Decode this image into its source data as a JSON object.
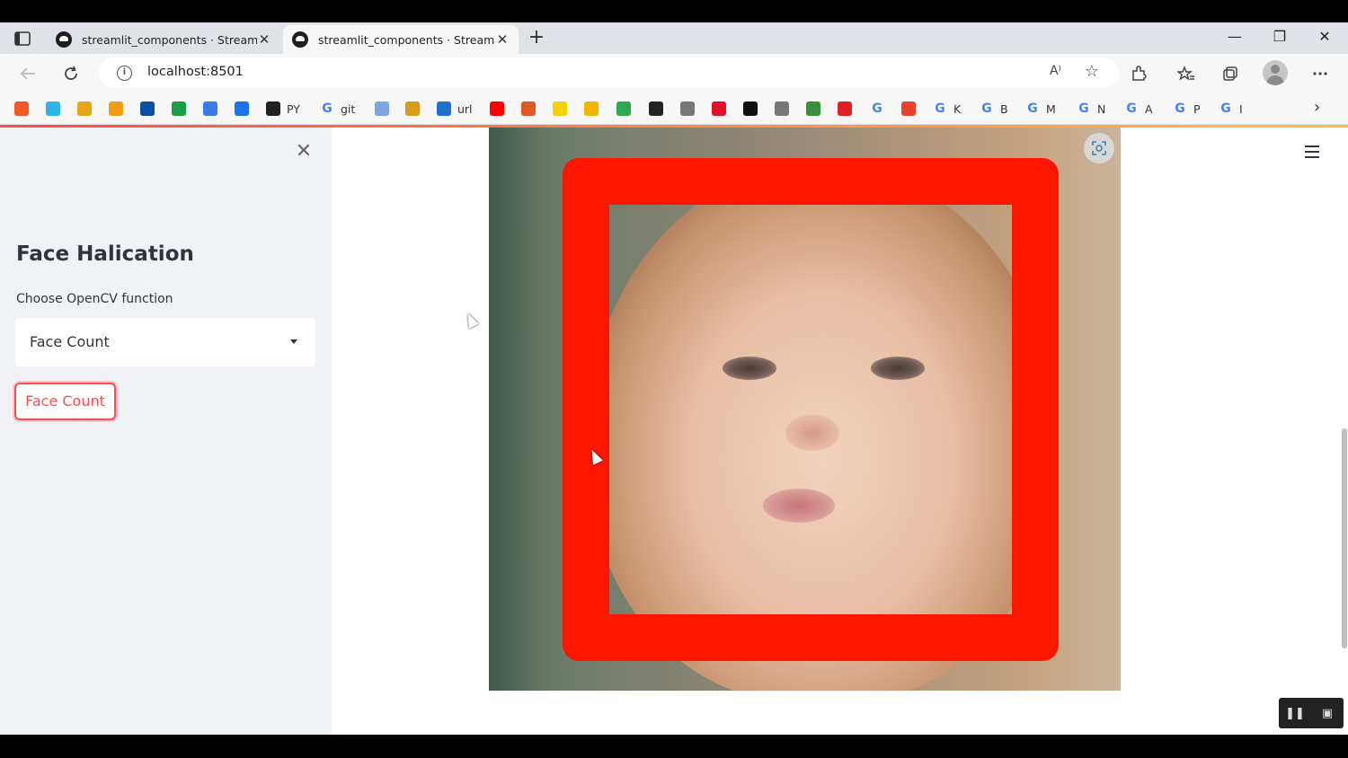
{
  "browser": {
    "tabs": [
      {
        "title": "streamlit_components · Streamlit",
        "active": false
      },
      {
        "title": "streamlit_components · Streamlit",
        "active": true
      }
    ],
    "new_tab_symbol": "+",
    "window_controls": {
      "minimize": "—",
      "restore": "❐",
      "close": "✕"
    },
    "url": "localhost:8501",
    "read_aloud": "A⁾",
    "bookmarks": [
      {
        "label": "",
        "icon": "bookmark-1-icon",
        "color": "#f05a28"
      },
      {
        "label": "",
        "icon": "bookmark-2-icon",
        "color": "#2fb4e8"
      },
      {
        "label": "",
        "icon": "bookmark-3-icon",
        "color": "#e8a417"
      },
      {
        "label": "",
        "icon": "bookmark-4-icon",
        "color": "#f29d12"
      },
      {
        "label": "",
        "icon": "ieee-icon",
        "color": "#0a4fa3"
      },
      {
        "label": "",
        "icon": "bookmark-6-icon",
        "color": "#1b9e45"
      },
      {
        "label": "",
        "icon": "bookmark-7-icon",
        "color": "#3b7be8"
      },
      {
        "label": "",
        "icon": "drive-icon",
        "color": "#1a73e8"
      },
      {
        "label": "PY",
        "icon": "github-icon",
        "color": "#222222"
      },
      {
        "label": "git",
        "icon": "google-icon",
        "color": "#4285f4"
      },
      {
        "label": "",
        "icon": "bookmark-11-icon",
        "color": "#7aa7e0"
      },
      {
        "label": "",
        "icon": "bookmark-12-icon",
        "color": "#d89b1a"
      },
      {
        "label": "url",
        "icon": "bookmark-13-icon",
        "color": "#1f6fd1"
      },
      {
        "label": "",
        "icon": "youtube-icon",
        "color": "#ff0000"
      },
      {
        "label": "",
        "icon": "bookmark-15-icon",
        "color": "#e25822"
      },
      {
        "label": "",
        "icon": "bookmark-16-icon",
        "color": "#f7d000"
      },
      {
        "label": "",
        "icon": "bookmark-17-icon",
        "color": "#f1b500"
      },
      {
        "label": "",
        "icon": "bookmark-18-icon",
        "color": "#2fa84f"
      },
      {
        "label": "",
        "icon": "bookmark-19-icon",
        "color": "#222222"
      },
      {
        "label": "",
        "icon": "document-icon",
        "color": "#777777"
      },
      {
        "label": "",
        "icon": "heart-icon",
        "color": "#e0102a"
      },
      {
        "label": "",
        "icon": "bookmark-22-icon",
        "color": "#111111"
      },
      {
        "label": "",
        "icon": "document-icon",
        "color": "#777777"
      },
      {
        "label": "",
        "icon": "bookmark-24-icon",
        "color": "#3a8f3a"
      },
      {
        "label": "",
        "icon": "bookmark-25-icon",
        "color": "#e02020"
      },
      {
        "label": "",
        "icon": "google-icon",
        "color": "#4285f4"
      },
      {
        "label": "",
        "icon": "bookmark-27-icon",
        "color": "#e8412c"
      },
      {
        "label": "K",
        "icon": "google-icon",
        "color": "#4285f4"
      },
      {
        "label": "B",
        "icon": "google-icon",
        "color": "#4285f4"
      },
      {
        "label": "M",
        "icon": "google-icon",
        "color": "#4285f4"
      },
      {
        "label": "N",
        "icon": "google-icon",
        "color": "#4285f4"
      },
      {
        "label": "A",
        "icon": "google-icon",
        "color": "#4285f4"
      },
      {
        "label": "P",
        "icon": "google-icon",
        "color": "#4285f4"
      },
      {
        "label": "I",
        "icon": "google-icon",
        "color": "#4285f4"
      }
    ]
  },
  "sidebar": {
    "close_symbol": "✕",
    "title": "Face Halication",
    "select_label": "Choose OpenCV function",
    "select_value": "Face Count",
    "button_label": "Face Count"
  },
  "main": {
    "image": {
      "frame_color": "#ff1500"
    }
  },
  "colors": {
    "accent": "#ff4b4b",
    "sidebar_bg": "#f0f2f6",
    "text": "#31333f"
  }
}
